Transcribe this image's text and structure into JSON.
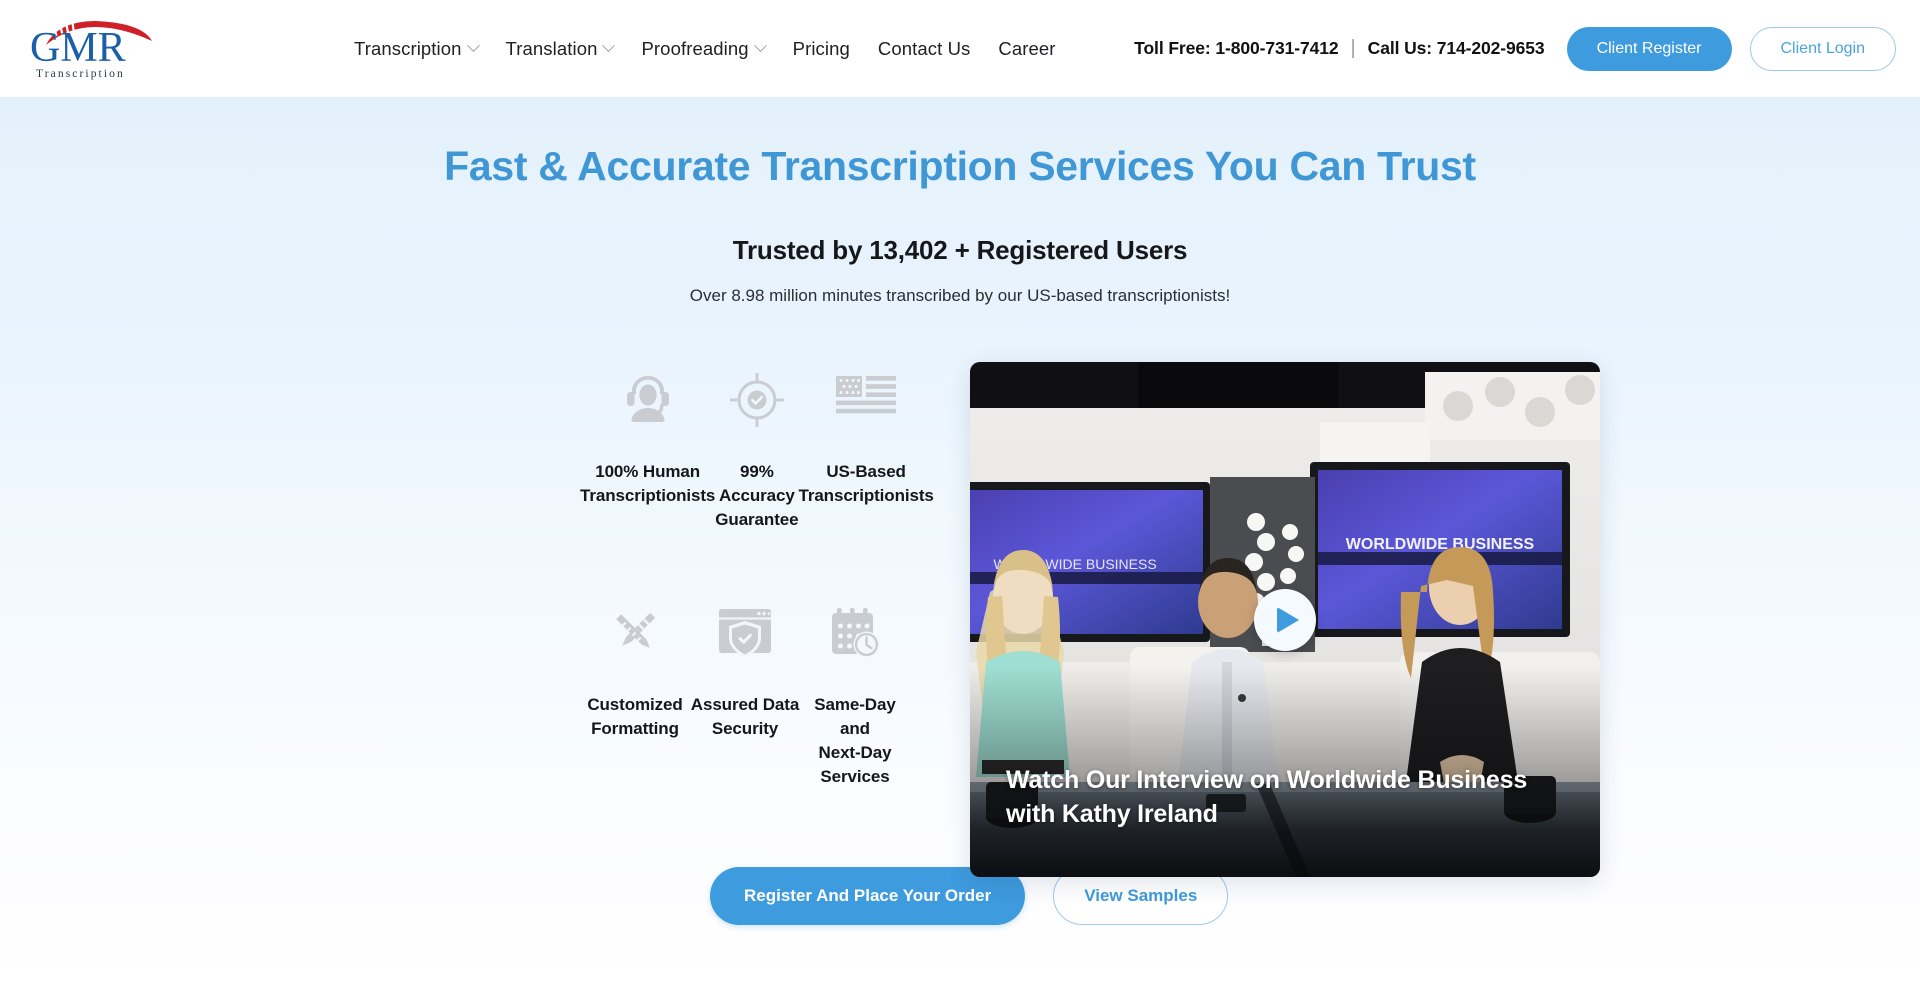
{
  "header": {
    "logo": {
      "name": "GMR",
      "subtitle": "Transcription"
    },
    "nav": [
      {
        "label": "Transcription",
        "has_dropdown": true
      },
      {
        "label": "Translation",
        "has_dropdown": true
      },
      {
        "label": "Proofreading",
        "has_dropdown": true
      },
      {
        "label": "Pricing",
        "has_dropdown": false
      },
      {
        "label": "Contact Us",
        "has_dropdown": false
      },
      {
        "label": "Career",
        "has_dropdown": false
      }
    ],
    "toll_free": "Toll Free: 1-800-731-7412",
    "separator": "|",
    "call_us": "Call Us: 714-202-9653",
    "client_register": "Client Register",
    "client_login": "Client Login"
  },
  "hero": {
    "title": "Fast & Accurate Transcription Services You Can Trust",
    "subtitle": "Trusted by 13,402 + Registered Users",
    "note": "Over 8.98 million minutes transcribed by our US-based transcriptionists!"
  },
  "features": [
    {
      "icon": "headset-agent-icon",
      "line1": "100% Human",
      "line2": "Transcriptionists"
    },
    {
      "icon": "target-check-icon",
      "line1": "99% Accuracy",
      "line2": "Guarantee"
    },
    {
      "icon": "us-flag-icon",
      "line1": "US-Based",
      "line2": "Transcriptionists"
    },
    {
      "icon": "pencil-ruler-icon",
      "line1": "Customized",
      "line2": "Formatting"
    },
    {
      "icon": "browser-shield-icon",
      "line1": "Assured Data",
      "line2": "Security"
    },
    {
      "icon": "calendar-clock-icon",
      "line1": "Same-Day and",
      "line2": "Next-Day Services"
    }
  ],
  "cta": {
    "primary": "Register And Place Your Order",
    "secondary": "View Samples"
  },
  "video": {
    "caption": "Watch Our Interview on Worldwide Business with Kathy Ireland",
    "play_label": "play-button",
    "screen_text": "WORLDWIDE BUSINESS"
  },
  "colors": {
    "brand_blue": "#3e9bdd",
    "title_blue": "#4097d6",
    "logo_blue": "#1b5fa8",
    "logo_red": "#cf2027",
    "icon_gray": "#c9ccd1",
    "text_dark": "#15171a",
    "hero_bg_top": "#e4f1fc",
    "hero_bg_bottom": "#ffffff"
  }
}
